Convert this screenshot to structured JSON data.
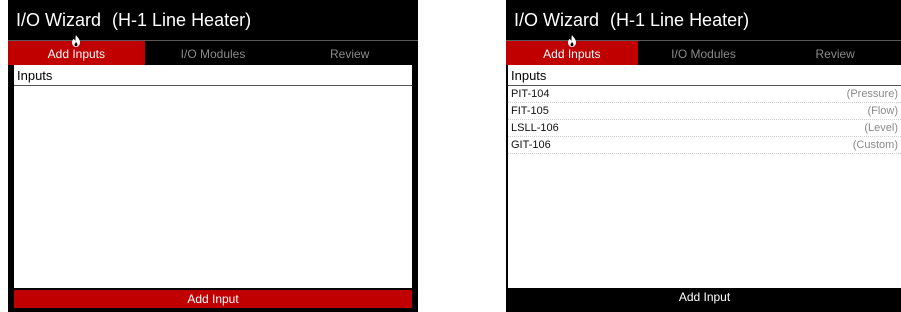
{
  "app": {
    "title": "I/O Wizard",
    "subtitle": "(H-1 Line Heater)"
  },
  "tabs": [
    {
      "label": "Add Inputs",
      "active": true
    },
    {
      "label": "I/O Modules",
      "active": false
    },
    {
      "label": "Review",
      "active": false
    }
  ],
  "inputs_header": "Inputs",
  "add_button_label": "Add Input",
  "colors": {
    "accent": "#c00000",
    "chrome": "#000000",
    "inactive_tab_text": "#8a8a8a"
  },
  "screens": {
    "empty": {
      "inputs": []
    },
    "filled": {
      "inputs": [
        {
          "name": "PIT-104",
          "type": "(Pressure)"
        },
        {
          "name": "FIT-105",
          "type": "(Flow)"
        },
        {
          "name": "LSLL-106",
          "type": "(Level)"
        },
        {
          "name": "GIT-106",
          "type": "(Custom)"
        }
      ]
    }
  }
}
